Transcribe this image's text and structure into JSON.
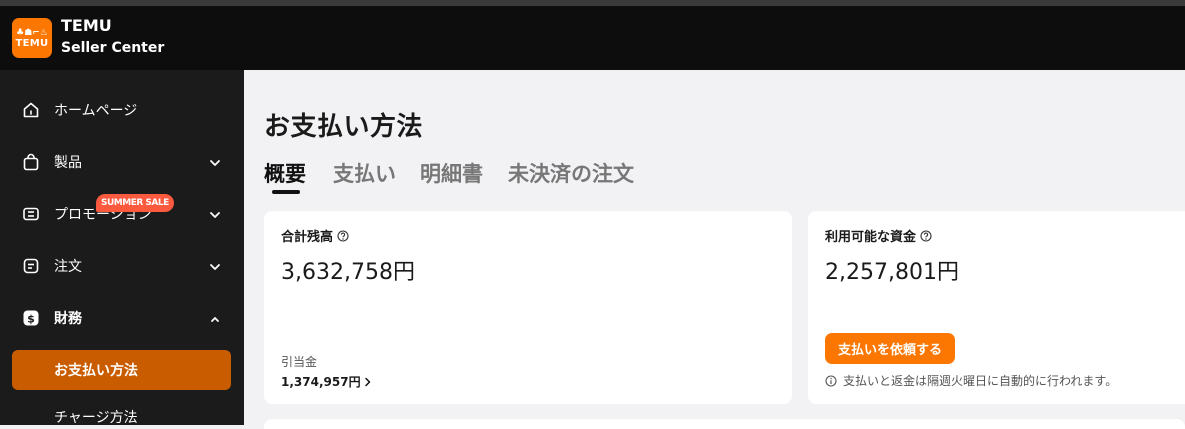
{
  "header": {
    "logo_glyphs": "♣☗⌐♨",
    "logo_word": "TEMU",
    "brand": "TEMU",
    "subtitle": "Seller Center"
  },
  "sidebar": {
    "items": [
      {
        "label": "ホームページ",
        "icon": "home-icon"
      },
      {
        "label": "製品",
        "icon": "bag-icon"
      },
      {
        "label": "プロモーション",
        "icon": "ticket-icon",
        "badge": "SUMMER SALE"
      },
      {
        "label": "注文",
        "icon": "order-icon"
      },
      {
        "label": "財務",
        "icon": "dollar-icon"
      }
    ],
    "active_sub": "お支払い方法",
    "next_sub": "チャージ方法"
  },
  "main": {
    "title": "お支払い方法",
    "tabs": [
      "概要",
      "支払い",
      "明細書",
      "未決済の注文"
    ],
    "active_tab": 0,
    "card_balance": {
      "label": "合計残高",
      "amount": "3,632,758円",
      "sub_label": "引当金",
      "sub_value": "1,374,957円"
    },
    "card_available": {
      "label": "利用可能な資金",
      "amount": "2,257,801円",
      "button": "支払いを依頼する",
      "note": "支払いと返金は隔週火曜日に自動的に行われます。"
    }
  },
  "colors": {
    "accent": "#fb7701",
    "active_nav": "#ca5c00",
    "badge": "#fb5a3e",
    "sidebar_bg": "#1b1b1b",
    "header_bg": "#0d0d0d"
  }
}
